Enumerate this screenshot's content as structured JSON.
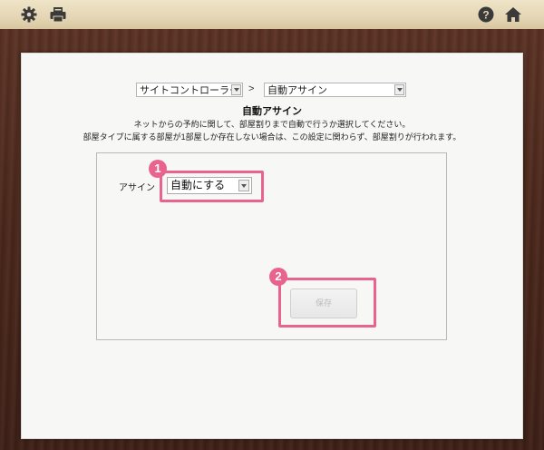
{
  "toolbar": {
    "settings_icon": "gear-icon",
    "print_icon": "print-icon",
    "help_icon": "help-icon",
    "home_icon": "home-icon"
  },
  "breadcrumb": {
    "first_select_value": "サイトコントローラー",
    "separator": ">",
    "second_select_value": "自動アサイン"
  },
  "page": {
    "title": "自動アサイン",
    "description_line1": "ネットからの予約に関して、部屋割りまで自動で行うか選択してください。",
    "description_line2": "部屋タイプに属する部屋が1部屋しか存在しない場合は、この設定に関わらず、部屋割りが行われます。"
  },
  "form": {
    "assign_label": "アサイン",
    "assign_value": "自動にする",
    "save_label": "保存"
  },
  "annotations": {
    "badge1": "1",
    "badge2": "2",
    "highlight_color": "#e8648e"
  }
}
